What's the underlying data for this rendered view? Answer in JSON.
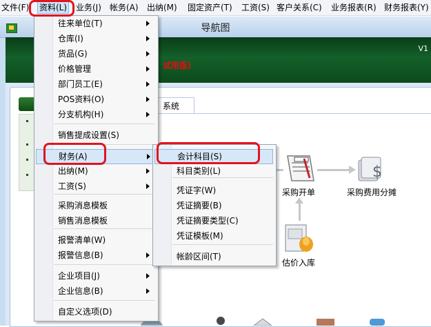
{
  "menubar": {
    "items": [
      "文件(F)",
      "资料(L)",
      "业务(J)",
      "帐务(A)",
      "出纳(M)",
      "固定资产(T)",
      "工资(S)",
      "客户关系(C)",
      "业务报表(R)",
      "财务报表(Y)"
    ]
  },
  "window": {
    "title": "导航图",
    "version_text": "V1",
    "trial_text": "试用版)",
    "tab_label": "系统"
  },
  "flow": {
    "labels": [
      "采购开单",
      "采购费用分摊",
      "估价入库"
    ]
  },
  "menu_data": {
    "items": [
      {
        "label": "往来单位(T)",
        "submenu": true
      },
      {
        "label": "仓库(I)",
        "submenu": true
      },
      {
        "label": "货品(G)",
        "submenu": true
      },
      {
        "label": "价格管理",
        "submenu": true
      },
      {
        "label": "部门员工(E)",
        "submenu": true
      },
      {
        "label": "POS资料(O)",
        "submenu": true
      },
      {
        "label": "分支机构(H)",
        "submenu": true
      },
      {
        "label": "销售提成设置(S)",
        "submenu": false
      },
      {
        "label": "财务(A)",
        "submenu": true,
        "highlighted": true
      },
      {
        "label": "出纳(M)",
        "submenu": true
      },
      {
        "label": "工资(S)",
        "submenu": true
      },
      {
        "label": "采购消息模板",
        "submenu": false
      },
      {
        "label": "销售消息模板",
        "submenu": false
      },
      {
        "label": "报警清单(W)",
        "submenu": false
      },
      {
        "label": "报警信息(B)",
        "submenu": true
      },
      {
        "label": "企业项目(J)",
        "submenu": true
      },
      {
        "label": "企业信息(B)",
        "submenu": true
      },
      {
        "label": "自定义选项(D)",
        "submenu": false
      }
    ]
  },
  "submenu_finance": {
    "items": [
      {
        "label": "会计科目(S)",
        "highlighted": true
      },
      {
        "label": "科目类别(L)"
      },
      {
        "label": "凭证字(W)"
      },
      {
        "label": "凭证摘要(B)"
      },
      {
        "label": "凭证摘要类型(C)"
      },
      {
        "label": "凭证模板(M)"
      },
      {
        "label": "帐龄区间(T)"
      }
    ]
  },
  "colors": {
    "highlight_outline": "#e0141e",
    "banner": "#0d4a1d",
    "menu_highlight": "#d6e7f8"
  }
}
